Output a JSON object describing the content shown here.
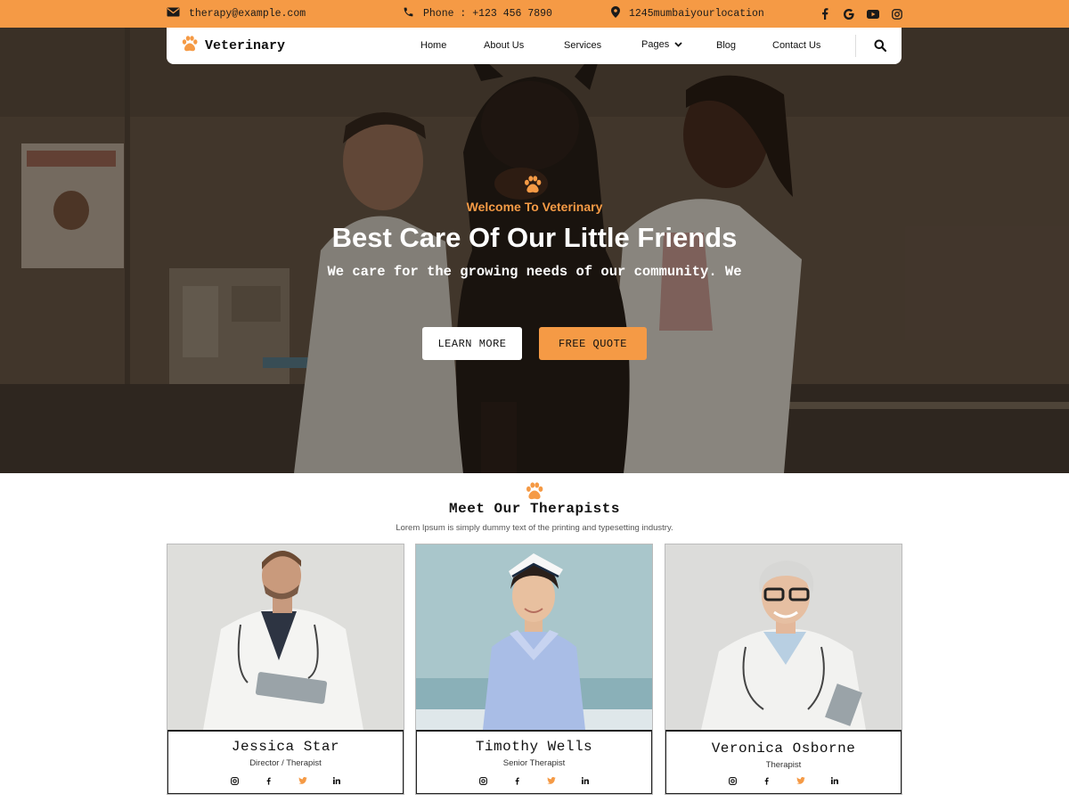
{
  "topbar": {
    "email": "therapy@example.com",
    "phone": "Phone : +123 456 7890",
    "location": "1245mumbaiyourlocation",
    "social_icons": [
      "facebook-icon",
      "google-icon",
      "youtube-icon",
      "instagram-icon"
    ]
  },
  "navbar": {
    "brand": "Veterinary",
    "links": {
      "home": "Home",
      "about": "About Us",
      "services": "Services",
      "pages": "Pages",
      "blog": "Blog",
      "contact": "Contact Us"
    }
  },
  "hero": {
    "welcome": "Welcome To Veterinary",
    "title": "Best Care Of Our Little Friends",
    "subtitle": "We care for the growing needs of our community. We",
    "learn_more": "LEARN MORE",
    "free_quote": "FREE QUOTE"
  },
  "therapists": {
    "title": "Meet Our Therapists",
    "subtitle": "Lorem Ipsum is simply dummy text of the printing and typesetting industry.",
    "cards": [
      {
        "name": "Jessica Star",
        "role": "Director / Therapist"
      },
      {
        "name": "Timothy Wells",
        "role": "Senior Therapist"
      },
      {
        "name": "Veronica Osborne",
        "role": "Therapist"
      }
    ]
  },
  "colors": {
    "accent": "#f59a45",
    "dark": "#111111",
    "white": "#ffffff"
  }
}
